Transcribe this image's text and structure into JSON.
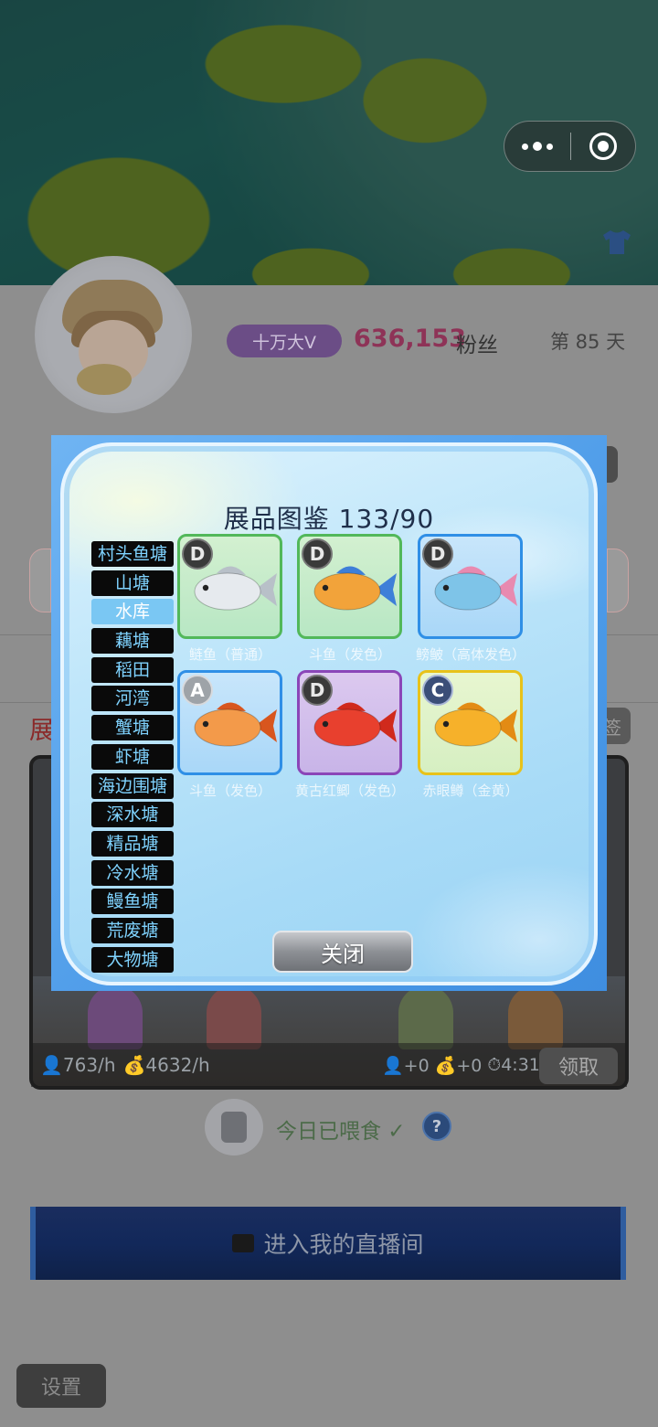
{
  "profile": {
    "v_badge": "十万大V",
    "fans_count": "636,153",
    "fans_label": "粉丝",
    "day_label": "第 85 天"
  },
  "section": {
    "title": "展",
    "side_button": "签"
  },
  "tank": {
    "fans_rate": "763/h",
    "coins_rate": "4632/h",
    "fans_gain": "+0",
    "coins_gain": "+0",
    "timer": "4:31",
    "claim_label": "领取"
  },
  "feed": {
    "status": "今日已喂食 ✓",
    "help": "?"
  },
  "live_button": "进入我的直播间",
  "settings_button": "设置",
  "modal": {
    "title": "展品图鉴 133/90",
    "close_label": "关闭",
    "ponds": [
      {
        "label": "村头鱼塘",
        "active": false
      },
      {
        "label": "山塘",
        "active": false
      },
      {
        "label": "水库",
        "active": true
      },
      {
        "label": "藕塘",
        "active": false
      },
      {
        "label": "稻田",
        "active": false
      },
      {
        "label": "河湾",
        "active": false
      },
      {
        "label": "蟹塘",
        "active": false
      },
      {
        "label": "虾塘",
        "active": false
      },
      {
        "label": "海边围塘",
        "active": false
      },
      {
        "label": "深水塘",
        "active": false
      },
      {
        "label": "精品塘",
        "active": false
      },
      {
        "label": "冷水塘",
        "active": false
      },
      {
        "label": "鳗鱼塘",
        "active": false
      },
      {
        "label": "荒废塘",
        "active": false
      },
      {
        "label": "大物塘",
        "active": false
      }
    ],
    "fish": [
      {
        "grade": "D",
        "name": "鲢鱼（普通）",
        "frame": "green",
        "color": "#e6eaee",
        "fin": "#b8c0c8"
      },
      {
        "grade": "D",
        "name": "斗鱼（发色）",
        "frame": "green",
        "color": "#f2a33a",
        "fin": "#3e7fd8"
      },
      {
        "grade": "D",
        "name": "鳑鲏（高体发色）",
        "frame": "blue",
        "color": "#7ec4e8",
        "fin": "#e88ab0"
      },
      {
        "grade": "A",
        "name": "斗鱼（发色）",
        "frame": "blue",
        "color": "#f39a4a",
        "fin": "#d8561e"
      },
      {
        "grade": "D",
        "name": "黄古红鲫（发色）",
        "frame": "purple",
        "color": "#e8402e",
        "fin": "#d02a1c"
      },
      {
        "grade": "C",
        "name": "赤眼鳟（金黄）",
        "frame": "gold",
        "color": "#f6b12a",
        "fin": "#e38b14"
      }
    ]
  }
}
